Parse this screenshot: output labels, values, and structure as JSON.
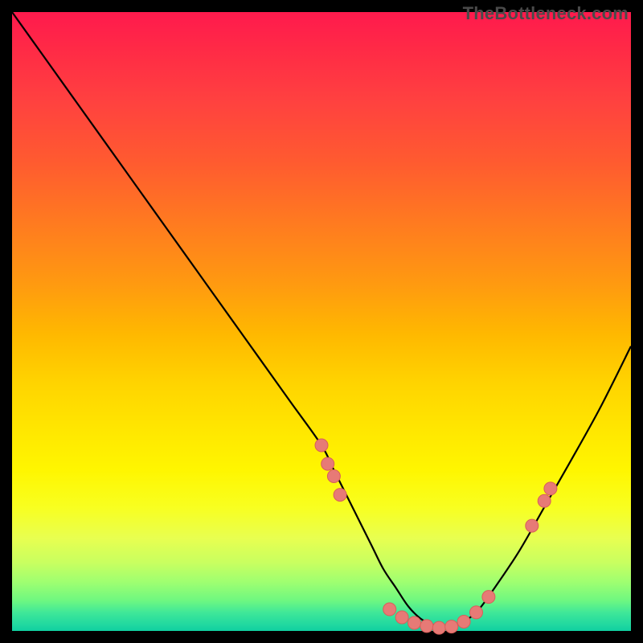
{
  "watermark": "TheBottleneck.com",
  "colors": {
    "curve_stroke": "#000000",
    "marker_fill": "#e77a76",
    "marker_stroke": "#d85f5a",
    "background": "#000000"
  },
  "chart_data": {
    "type": "line",
    "title": "",
    "xlabel": "",
    "ylabel": "",
    "xlim": [
      0,
      100
    ],
    "ylim": [
      0,
      100
    ],
    "grid": false,
    "legend": false,
    "series": [
      {
        "name": "bottleneck-curve",
        "x": [
          0,
          5,
          10,
          15,
          20,
          25,
          30,
          35,
          40,
          45,
          50,
          52,
          55,
          58,
          60,
          62,
          64,
          66,
          68,
          70,
          72,
          75,
          78,
          82,
          86,
          90,
          95,
          100
        ],
        "y": [
          100,
          93,
          86,
          79,
          72,
          65,
          58,
          51,
          44,
          37,
          30,
          26,
          20,
          14,
          10,
          7,
          4,
          2,
          1,
          0.5,
          1,
          3,
          7,
          13,
          20,
          27,
          36,
          46
        ]
      }
    ],
    "markers": [
      {
        "x": 50,
        "y": 30
      },
      {
        "x": 51,
        "y": 27
      },
      {
        "x": 52,
        "y": 25
      },
      {
        "x": 53,
        "y": 22
      },
      {
        "x": 61,
        "y": 3.5
      },
      {
        "x": 63,
        "y": 2.2
      },
      {
        "x": 65,
        "y": 1.3
      },
      {
        "x": 67,
        "y": 0.8
      },
      {
        "x": 69,
        "y": 0.5
      },
      {
        "x": 71,
        "y": 0.7
      },
      {
        "x": 73,
        "y": 1.5
      },
      {
        "x": 75,
        "y": 3.0
      },
      {
        "x": 77,
        "y": 5.5
      },
      {
        "x": 84,
        "y": 17
      },
      {
        "x": 86,
        "y": 21
      },
      {
        "x": 87,
        "y": 23
      }
    ],
    "note": "Values are approximate, read visually from the unlabeled curve. y=0 is the green bottom edge; y=100 is the top red edge. The curve has its minimum near x≈69."
  }
}
